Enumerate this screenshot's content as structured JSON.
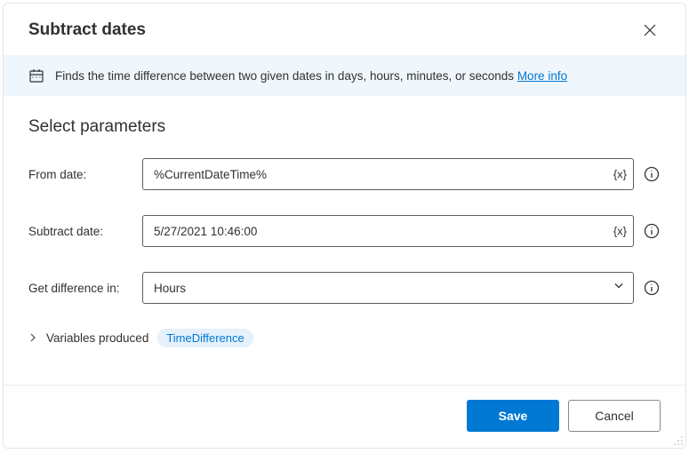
{
  "header": {
    "title": "Subtract dates"
  },
  "info": {
    "text": "Finds the time difference between two given dates in days, hours, minutes, or seconds",
    "more_link": "More info"
  },
  "section": {
    "title": "Select parameters"
  },
  "fields": {
    "from_date": {
      "label": "From date:",
      "value": "%CurrentDateTime%"
    },
    "subtract_date": {
      "label": "Subtract date:",
      "value": "5/27/2021 10:46:00"
    },
    "get_diff": {
      "label": "Get difference in:",
      "value": "Hours"
    }
  },
  "variables": {
    "label": "Variables produced",
    "badge": "TimeDifference"
  },
  "footer": {
    "save": "Save",
    "cancel": "Cancel"
  },
  "icons": {
    "variable_token": "{x}"
  }
}
